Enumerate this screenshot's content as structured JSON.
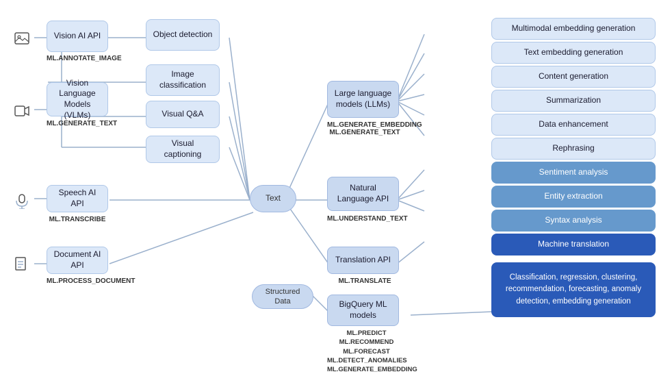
{
  "nodes": {
    "vision_ai": {
      "label": "Vision AI API",
      "sublabel": "ML.ANNOTATE_IMAGE"
    },
    "vlm": {
      "label": "Vision Language\nModels (VLMs)",
      "sublabel": "ML.GENERATE_TEXT"
    },
    "speech": {
      "label": "Speech AI API",
      "sublabel": "ML.TRANSCRIBE"
    },
    "document": {
      "label": "Document AI API",
      "sublabel": "ML.PROCESS_DOCUMENT"
    },
    "object_det": {
      "label": "Object\ndetection"
    },
    "image_class": {
      "label": "Image\nclassification"
    },
    "visual_qa": {
      "label": "Visual Q&A"
    },
    "visual_caption": {
      "label": "Visual captioning"
    },
    "text_hub": {
      "label": "Text"
    },
    "structured_hub": {
      "label": "Structured Data"
    },
    "llm": {
      "label": "Large language\nmodels (LLMs)",
      "sublabel": "ML.GENERATE_EMBEDDING\nML.GENERATE_TEXT"
    },
    "nlp": {
      "label": "Natural\nLanguage API",
      "sublabel": "ML.UNDERSTAND_TEXT"
    },
    "translation": {
      "label": "Translation API",
      "sublabel": "ML.TRANSLATE"
    },
    "bigquery": {
      "label": "BigQuery ML\nmodels",
      "sublabel": "ML.PREDICT\nML.RECOMMEND\nML.FORECAST\nML.DETECT_ANOMALIES\nML.GENERATE_EMBEDDING"
    },
    "multimodal": {
      "label": "Multimodal embedding generation"
    },
    "text_embed": {
      "label": "Text embedding generation"
    },
    "content_gen": {
      "label": "Content generation"
    },
    "summarization": {
      "label": "Summarization"
    },
    "data_enhance": {
      "label": "Data enhancement"
    },
    "rephrasing": {
      "label": "Rephrasing"
    },
    "sentiment": {
      "label": "Sentiment analysis"
    },
    "entity": {
      "label": "Entity extraction"
    },
    "syntax": {
      "label": "Syntax analysis"
    },
    "machine_trans": {
      "label": "Machine translation"
    },
    "classification": {
      "label": "Classification, regression, clustering,\nrecommendation, forecasting,\nanomaly detection,\nembedding generation"
    }
  },
  "icons": {
    "image_icon": "🖼",
    "video_icon": "🎬",
    "speech_icon": "🎙",
    "document_icon": "📄"
  }
}
